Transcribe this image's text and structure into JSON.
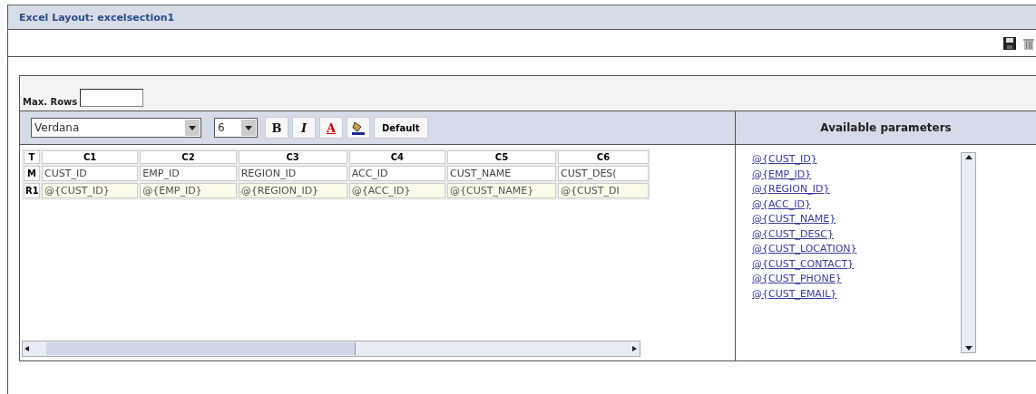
{
  "window": {
    "title": "Excel Layout: excelsection1"
  },
  "max_rows": {
    "label": "Max. Rows"
  },
  "format_toolbar": {
    "font": "Verdana",
    "size": "6",
    "bold": "B",
    "italic": "I",
    "font_color": "A",
    "default_button": "Default"
  },
  "grid": {
    "corner": "T",
    "columns": [
      "C1",
      "C2",
      "C3",
      "C4",
      "C5",
      "C6"
    ],
    "rows": [
      {
        "label": "M",
        "kind": "header",
        "cells": [
          "CUST_ID",
          "EMP_ID",
          "REGION_ID",
          "ACC_ID",
          "CUST_NAME",
          "CUST_DES("
        ]
      },
      {
        "label": "R1",
        "kind": "data",
        "cells": [
          "@{CUST_ID}",
          "@{EMP_ID}",
          "@{REGION_ID}",
          "@{ACC_ID}",
          "@{CUST_NAME}",
          "@{CUST_DI"
        ]
      }
    ]
  },
  "parameters": {
    "title": "Available parameters",
    "items": [
      "@{CUST_ID}",
      "@{EMP_ID}",
      "@{REGION_ID}",
      "@{ACC_ID}",
      "@{CUST_NAME}",
      "@{CUST_DESC}",
      "@{CUST_LOCATION}",
      "@{CUST_CONTACT}",
      "@{CUST_PHONE}",
      "@{CUST_EMAIL}"
    ]
  }
}
